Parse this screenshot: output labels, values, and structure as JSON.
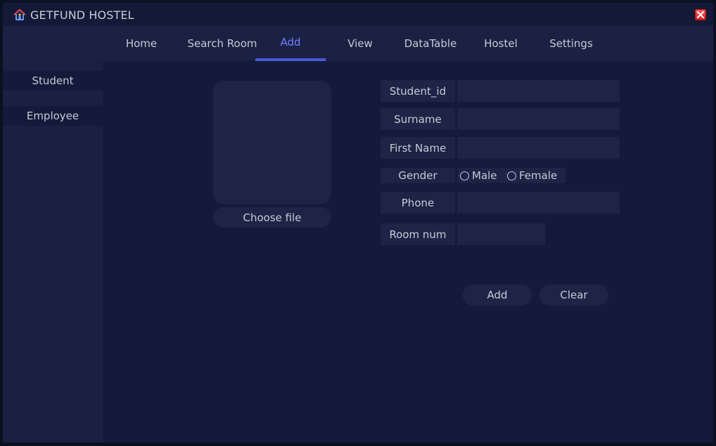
{
  "window": {
    "title": "GETFUND HOSTEL"
  },
  "nav": {
    "tabs": [
      {
        "label": "Home"
      },
      {
        "label": "Search Room"
      },
      {
        "label": "Add"
      },
      {
        "label": "View"
      },
      {
        "label": "DataTable"
      },
      {
        "label": "Hostel"
      },
      {
        "label": "Settings"
      }
    ],
    "active_tab": "Add"
  },
  "sidebar": {
    "items": [
      {
        "label": "Student"
      },
      {
        "label": "Employee"
      }
    ]
  },
  "form": {
    "choose_file_label": "Choose file",
    "fields": {
      "student_id": {
        "label": "Student_id",
        "value": ""
      },
      "surname": {
        "label": "Surname",
        "value": ""
      },
      "first_name": {
        "label": "First Name",
        "value": ""
      },
      "gender": {
        "label": "Gender",
        "options": [
          "Male",
          "Female"
        ],
        "selected": ""
      },
      "phone": {
        "label": "Phone",
        "value": ""
      },
      "room_num": {
        "label": "Room num",
        "value": ""
      }
    },
    "buttons": {
      "add": "Add",
      "clear": "Clear"
    }
  },
  "icons": {
    "app": "house-icon",
    "close": "close-icon",
    "radio": "radio-button-icon"
  },
  "colors": {
    "accent": "#4659d7",
    "active_text": "#6f80ff",
    "close": "#e11d1d",
    "background": "#141a39",
    "panel": "#1d2445"
  }
}
